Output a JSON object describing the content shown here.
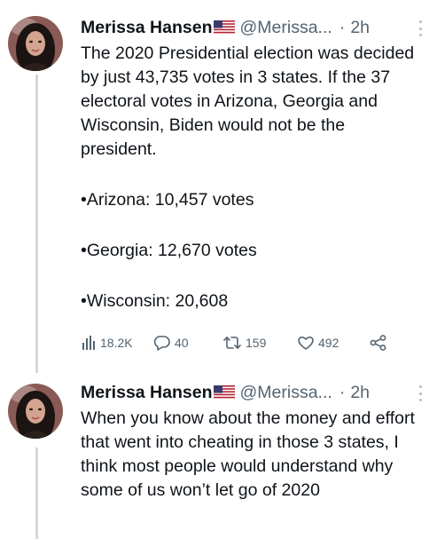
{
  "tweets": [
    {
      "author_name": "Merissa Hansen",
      "handle": "@Merissa...",
      "separator": "·",
      "time": "2h",
      "paragraphs": [
        "The 2020 Presidential election was decided by just 43,735 votes in 3 states. If the 37 electoral votes in Arizona, Georgia and Wisconsin, Biden would not be the president.",
        "•Arizona: 10,457 votes",
        "•Georgia: 12,670 votes",
        "•Wisconsin: 20,608"
      ],
      "stats": {
        "views": "18.2K",
        "replies": "40",
        "retweets": "159",
        "likes": "492"
      }
    },
    {
      "author_name": "Merissa Hansen",
      "handle": "@Merissa...",
      "separator": "·",
      "time": "2h",
      "paragraphs": [
        "When you know about the money and effort that went into cheating in those 3 states, I think most people would understand why some of us won’t let go of 2020"
      ]
    }
  ],
  "icons": {
    "flag": "us-flag-icon",
    "more": "more-options-icon",
    "views": "bar-chart-icon",
    "reply": "reply-bubble-icon",
    "retweet": "retweet-icon",
    "like": "heart-icon",
    "share": "share-icon"
  },
  "colors": {
    "text": "#0f1419",
    "secondary": "#536471",
    "thread_line": "#cfd9de"
  }
}
